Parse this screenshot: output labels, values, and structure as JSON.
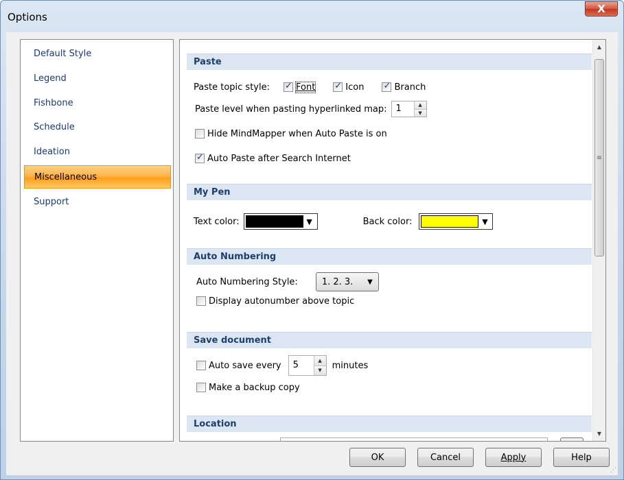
{
  "window": {
    "title": "Options",
    "close_glyph": "X"
  },
  "nav": {
    "items": [
      {
        "label": "Default Style",
        "selected": false
      },
      {
        "label": "Legend",
        "selected": false
      },
      {
        "label": "Fishbone",
        "selected": false
      },
      {
        "label": "Schedule",
        "selected": false
      },
      {
        "label": "Ideation",
        "selected": false
      },
      {
        "label": "Miscellaneous",
        "selected": true
      },
      {
        "label": "Support",
        "selected": false
      }
    ]
  },
  "paste": {
    "header": "Paste",
    "topic_style_label": "Paste topic style:",
    "font_label": "Font",
    "font_checked": true,
    "icon_label": "Icon",
    "icon_checked": true,
    "branch_label": "Branch",
    "branch_checked": true,
    "level_label": "Paste level when pasting hyperlinked map:",
    "level_value": "1",
    "hide_label": "Hide MindMapper when Auto Paste is on",
    "hide_checked": false,
    "auto_paste_label": "Auto Paste after Search Internet",
    "auto_paste_checked": true
  },
  "mypen": {
    "header": "My Pen",
    "text_color_label": "Text color:",
    "text_color": "#000000",
    "back_color_label": "Back color:",
    "back_color": "#ffff00"
  },
  "numbering": {
    "header": "Auto Numbering",
    "style_label": "Auto Numbering Style:",
    "style_value": "1. 2. 3.",
    "display_label": "Display autonumber above topic",
    "display_checked": false
  },
  "save": {
    "header": "Save document",
    "auto_save_label": "Auto save every",
    "auto_save_checked": false,
    "minutes_value": "5",
    "minutes_label": "minutes",
    "backup_label": "Make a backup copy",
    "backup_checked": false
  },
  "location": {
    "header": "Location"
  },
  "buttons": {
    "ok": "OK",
    "cancel": "Cancel",
    "apply": "Apply",
    "help": "Help"
  },
  "icons": {
    "scroll_up": "▲",
    "scroll_down": "▼",
    "grip": "≡",
    "dropdown": "▼",
    "spin_up": "▲",
    "spin_down": "▼"
  }
}
